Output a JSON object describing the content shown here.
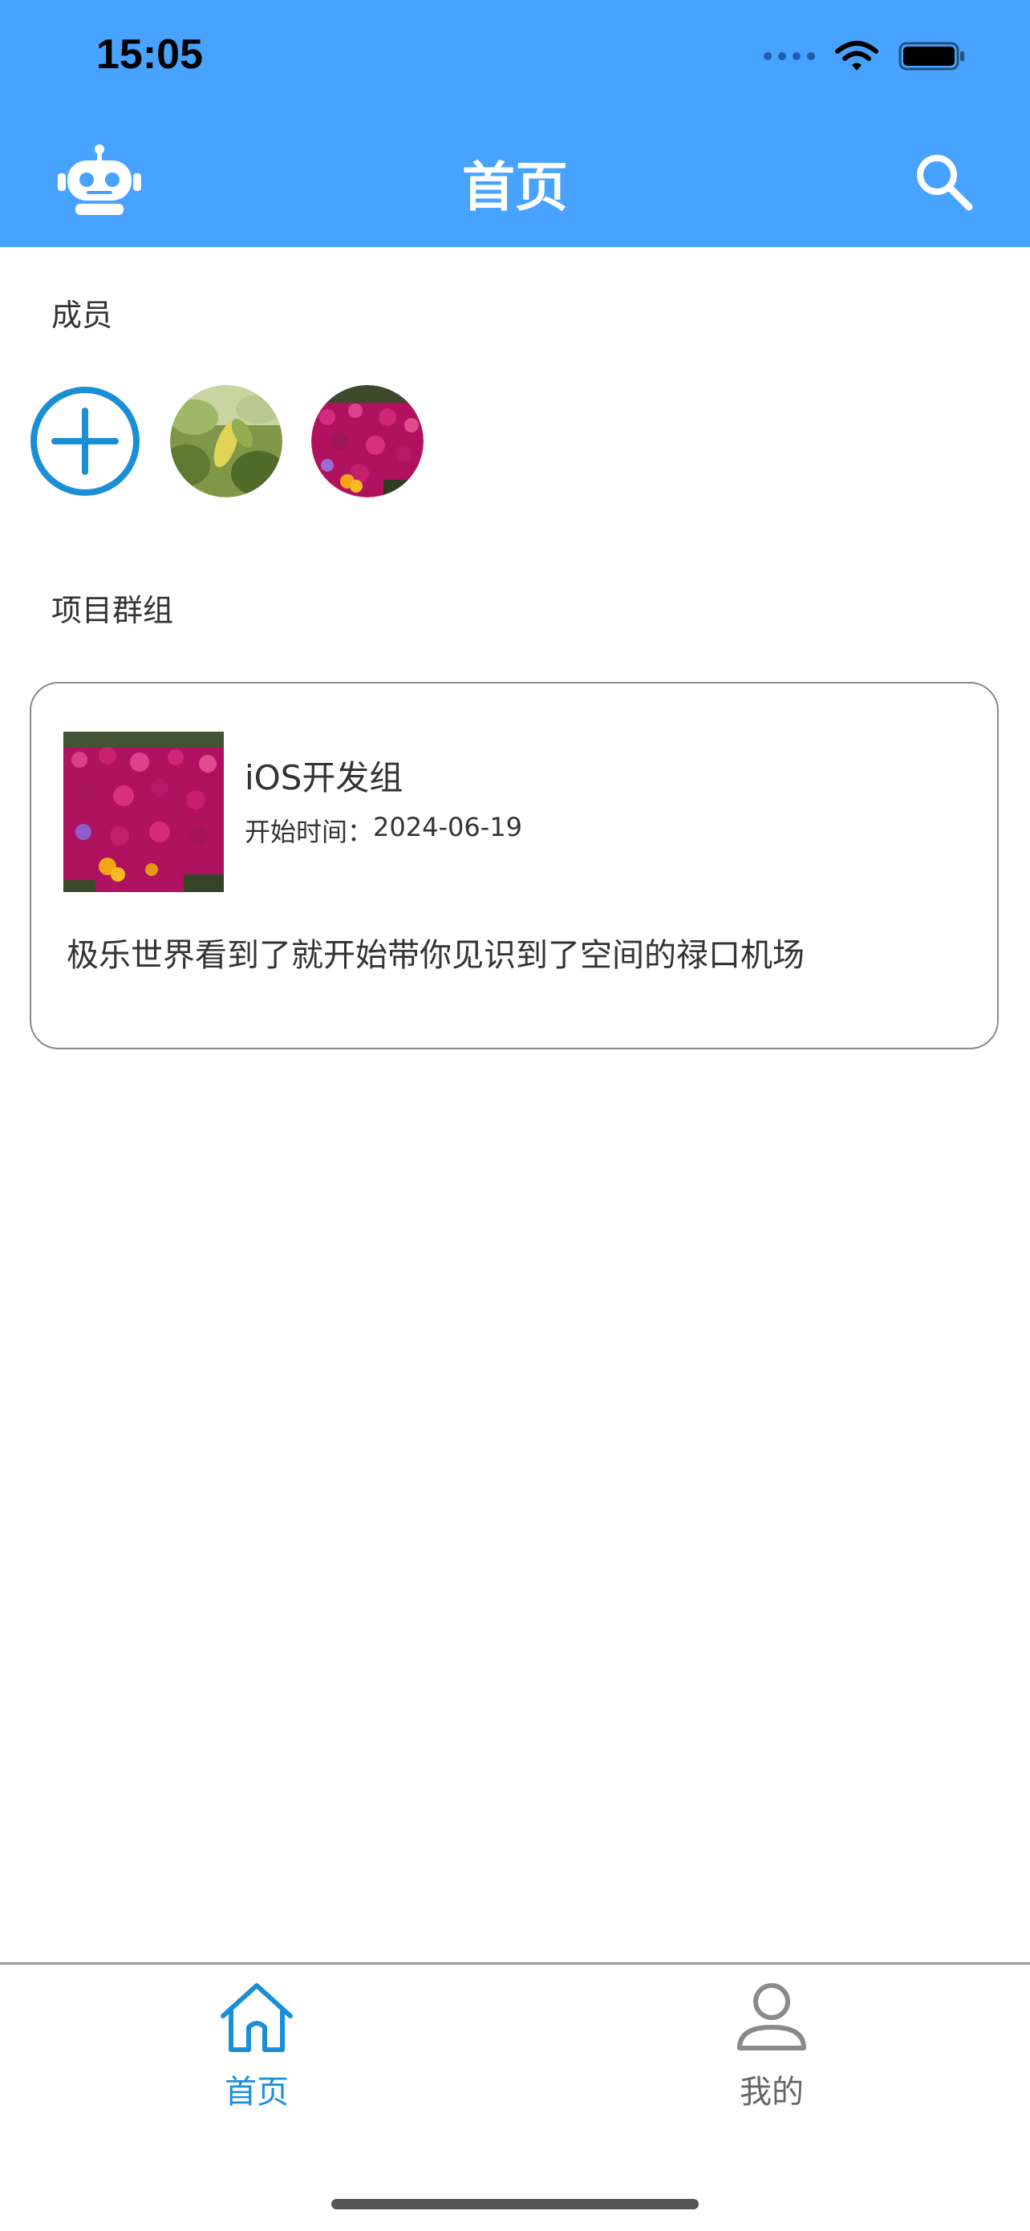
{
  "status_bar": {
    "time": "15:05"
  },
  "nav": {
    "title": "首页",
    "left_icon": "robot-icon",
    "right_icon": "search-icon"
  },
  "members": {
    "section_title": "成员",
    "add_icon": "add-circle-icon",
    "avatars": [
      "leaf-photo",
      "flower-photo"
    ]
  },
  "groups": {
    "section_title": "项目群组",
    "cards": [
      {
        "name": "iOS开发组",
        "start_label": "开始时间：",
        "start_date": "2024-06-19",
        "description": "极乐世界看到了就开始带你见识到了空间的禄口机场"
      }
    ]
  },
  "tabbar": {
    "tabs": [
      {
        "label": "首页",
        "icon": "home-icon",
        "active": true
      },
      {
        "label": "我的",
        "icon": "user-icon",
        "active": false
      }
    ]
  },
  "colors": {
    "header": "#47a3ff",
    "accent": "#1a8fd8",
    "inactive": "#8a8a8a"
  }
}
